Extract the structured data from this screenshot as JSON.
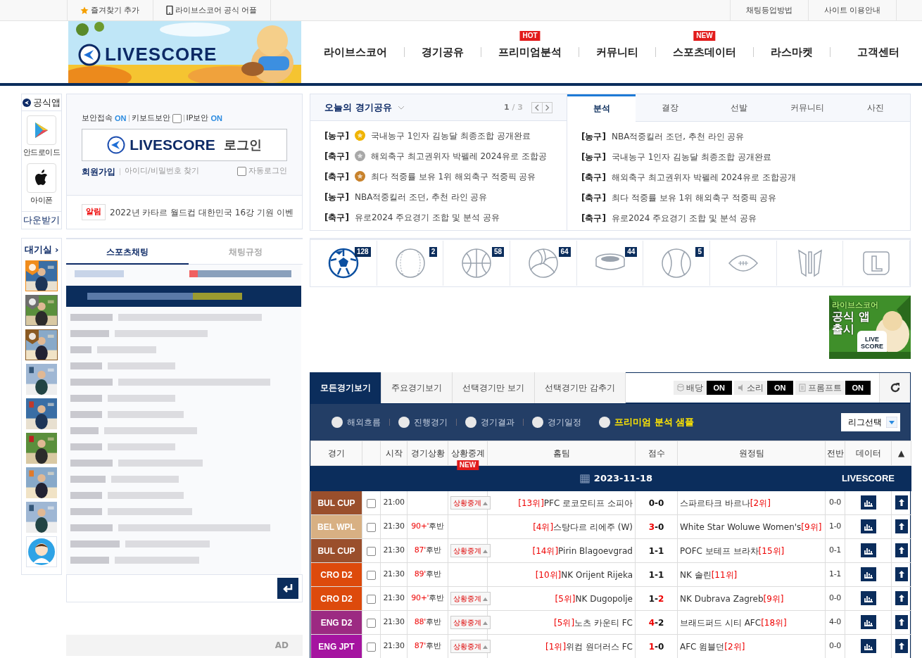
{
  "top_bar": {
    "left": [
      {
        "kind": "star",
        "label": "즐겨찾기 추가"
      },
      {
        "kind": "phone",
        "label": "라이브스코어 공식 어플"
      }
    ],
    "right": [
      "채팅등업방법",
      "사이트 이용안내"
    ]
  },
  "header": {
    "logo": "LIVESCORE",
    "nav": [
      {
        "label": "라이브스코어"
      },
      {
        "label": "경기공유"
      },
      {
        "label": "프리미엄분석",
        "badge": "HOT"
      },
      {
        "label": "커뮤니티"
      },
      {
        "label": "스포츠데이터",
        "badge": "NEW"
      },
      {
        "label": "라스마켓"
      },
      {
        "label": "고객센터"
      }
    ]
  },
  "app_panel": {
    "title": "공식앱",
    "items": [
      {
        "kind": "android",
        "label": "안드로이드"
      },
      {
        "kind": "apple",
        "label": "아이폰"
      }
    ],
    "download": "다운받기"
  },
  "login": {
    "security": [
      {
        "label": "보안접속",
        "kind": "status",
        "value": "ON"
      },
      {
        "label": "키보드보안",
        "kind": "checkbox",
        "checked": false
      },
      {
        "label": "IP보안",
        "kind": "status",
        "value": "ON"
      }
    ],
    "button_logo": "LIVESCORE",
    "button_label": "로그인",
    "signup": "회원가입",
    "find": "아이디/비밀번호 찾기",
    "auto_login": {
      "label": "자동로그인",
      "checked": false
    },
    "notice": {
      "badge": "알림",
      "text": "2022년 카타르 월드컵 대한민국 16강 기원 이벤"
    }
  },
  "today_share": {
    "title": "오늘의 경기공유",
    "page_current": "1",
    "page_total": "/ 3",
    "items": [
      {
        "category": "[농구]",
        "color": "#f0b400",
        "title": "국내농구 1인자 김농달 최종조합 공개완료"
      },
      {
        "category": "[축구]",
        "color": "#a8a8a8",
        "title": "해외축구 최고권위자 박펠레 2024유로 조합공"
      },
      {
        "category": "[축구]",
        "color": "#c8822c",
        "title": "최다 적중률 보유 1위 해외축구 적중픽 공유"
      },
      {
        "category": "[농구]",
        "title": "NBA적중킬러 조던, 추천 라인 공유"
      },
      {
        "category": "[축구]",
        "title": "유로2024 주요경기 조합 및 분석 공유"
      }
    ]
  },
  "board": {
    "tabs": [
      {
        "label": "분석",
        "selected": true
      },
      {
        "label": "결장",
        "selected": false
      },
      {
        "label": "선발",
        "selected": false
      },
      {
        "label": "커뮤니티",
        "selected": false
      },
      {
        "label": "사진",
        "selected": false
      }
    ],
    "items": [
      {
        "category": "[농구]",
        "title": "NBA적중킬러 조던, 추천 라인 공유"
      },
      {
        "category": "[농구]",
        "title": "국내농구 1인자 김농달 최종조합 공개완료"
      },
      {
        "category": "[축구]",
        "title": "해외축구 최고권위자 박펠레 2024유로 조합공개"
      },
      {
        "category": "[축구]",
        "title": "최다 적중률 보유 1위 해외축구 적중픽 공유"
      },
      {
        "category": "[축구]",
        "title": "유로2024 주요경기 조합 및 분석 공유"
      }
    ]
  },
  "waiting_room": {
    "title": "대기실 ›",
    "members": [
      {
        "kind": "picture",
        "color": "#f08c1c"
      },
      {
        "kind": "picture",
        "color": "#6e6e6e"
      },
      {
        "kind": "picture",
        "color": "#8a5a24"
      },
      {
        "kind": "picture"
      },
      {
        "kind": "picture"
      },
      {
        "kind": "picture"
      },
      {
        "kind": "picture"
      },
      {
        "kind": "picture"
      },
      {
        "kind": "avatar"
      }
    ]
  },
  "chat": {
    "tabs": [
      {
        "label": "스포츠채팅",
        "selected": true
      },
      {
        "label": "채팅규정",
        "selected": false
      }
    ],
    "ad": "AD"
  },
  "sports": [
    {
      "kind": "soccer",
      "count": "128",
      "selected": true
    },
    {
      "kind": "baseball",
      "count": "2",
      "selected": false
    },
    {
      "kind": "basketball",
      "count": "58",
      "selected": false
    },
    {
      "kind": "volleyball",
      "count": "64",
      "selected": false
    },
    {
      "kind": "hockey",
      "count": "44",
      "selected": false
    },
    {
      "kind": "tennis",
      "count": "5",
      "selected": false
    },
    {
      "kind": "football",
      "selected": false
    },
    {
      "kind": "esports",
      "selected": false
    },
    {
      "kind": "lol",
      "selected": false
    }
  ],
  "promo": {
    "lines": [
      "라이브스코어",
      "공식 앱",
      "출시"
    ],
    "logo": "LIVE SCORE"
  },
  "matches": {
    "tabs": [
      {
        "label": "모든경기보기",
        "selected": true
      },
      {
        "label": "주요경기보기",
        "selected": false
      },
      {
        "label": "선택경기만 보기",
        "selected": false
      },
      {
        "label": "선택경기만 감추기",
        "selected": false
      }
    ],
    "toggles": [
      {
        "kind": "coin",
        "label": "배당",
        "value": "ON",
        "on": true
      },
      {
        "kind": "sound",
        "label": "소리",
        "value": "ON",
        "on": true
      },
      {
        "kind": "doc",
        "label": "프롬프트",
        "value": "ON",
        "on": true
      }
    ],
    "filters": [
      {
        "label": "해외흐름",
        "kind": "plain",
        "selected": false
      },
      {
        "label": "진행경기",
        "kind": "plain",
        "selected": false
      },
      {
        "label": "경기결과",
        "kind": "plain",
        "selected": false
      },
      {
        "label": "경기일정",
        "kind": "plain",
        "selected": false
      },
      {
        "label": "프리미엄 분석 샘플",
        "kind": "premium",
        "selected": false
      }
    ],
    "league_select": "리그선택",
    "columns": [
      {
        "label": "경기"
      },
      {
        "label": "시작"
      },
      {
        "label": "경기상황"
      },
      {
        "label": "상황중계",
        "badge": "NEW"
      },
      {
        "label": "홈팀"
      },
      {
        "label": "점수"
      },
      {
        "label": "원정팀"
      },
      {
        "label": "전반"
      },
      {
        "label": "데이터"
      },
      {
        "label": "▲"
      }
    ],
    "date": "2023-11-18",
    "brand": "LIVESCORE",
    "rows": [
      {
        "league": "BUL CUP",
        "color": "#9a4f2c",
        "checked": false,
        "time": "21:00",
        "relay": "상황중계",
        "home_rank": "[13위]",
        "home": "PFC 로코모티프 소피아",
        "score": "0-0",
        "home_leading": false,
        "away_leading": false,
        "away": "스파르타크 바르나",
        "away_rank": "[2위]",
        "half": "0-0"
      },
      {
        "league": "BEL WPL",
        "color": "#d8b083",
        "checked": false,
        "time": "21:30",
        "minute": "90+'",
        "period": "후반",
        "home_rank": "[4위]",
        "home": "스탕다르 리에주 (W)",
        "score": "3-0",
        "home_leading": true,
        "away_leading": false,
        "away": "White Star Woluwe Women's",
        "away_rank": "[9위]",
        "half": "1-0"
      },
      {
        "league": "BUL CUP",
        "color": "#9a4f2c",
        "checked": false,
        "time": "21:30",
        "minute": "87'",
        "period": "후반",
        "relay": "상황중계",
        "home_rank": "[14위]",
        "home": "Pirin Blagoevgrad",
        "score": "1-1",
        "home_leading": false,
        "away_leading": false,
        "away": "POFC 보테프 브라차",
        "away_rank": "[15위]",
        "half": "0-1"
      },
      {
        "league": "CRO D2",
        "color": "#dd4a0c",
        "checked": false,
        "time": "21:30",
        "minute": "89'",
        "period": "후반",
        "home_rank": "[10위]",
        "home": "NK Orijent Rijeka",
        "score": "1-1",
        "home_leading": false,
        "away_leading": false,
        "away": "NK 솔린",
        "away_rank": "[11위]",
        "half": "1-1"
      },
      {
        "league": "CRO D2",
        "color": "#dd4a0c",
        "checked": false,
        "time": "21:30",
        "minute": "90+'",
        "period": "후반",
        "relay": "상황중계",
        "home_rank": "[5위]",
        "home": "NK Dugopolje",
        "score": "1-2",
        "home_leading": false,
        "away_leading": true,
        "away": "NK Dubrava Zagreb",
        "away_rank": "[9위]",
        "half": "0-0"
      },
      {
        "league": "ENG D2",
        "color": "#9c2a82",
        "checked": false,
        "time": "21:30",
        "minute": "88'",
        "period": "후반",
        "relay": "상황중계",
        "home_rank": "[5위]",
        "home": "노츠 카운티 FC",
        "score": "4-2",
        "home_leading": true,
        "away_leading": false,
        "away": "브래드퍼드 시티 AFC",
        "away_rank": "[18위]",
        "half": "4-0"
      },
      {
        "league": "ENG JPT",
        "color": "#a514a0",
        "checked": false,
        "time": "21:30",
        "minute": "87'",
        "period": "후반",
        "relay": "상황중계",
        "home_rank": "[1위]",
        "home": "위컴 원더러스 FC",
        "score": "1-0",
        "home_leading": true,
        "away_leading": false,
        "away": "AFC 윔블던",
        "away_rank": "[2위]",
        "half": "0-0"
      }
    ]
  }
}
